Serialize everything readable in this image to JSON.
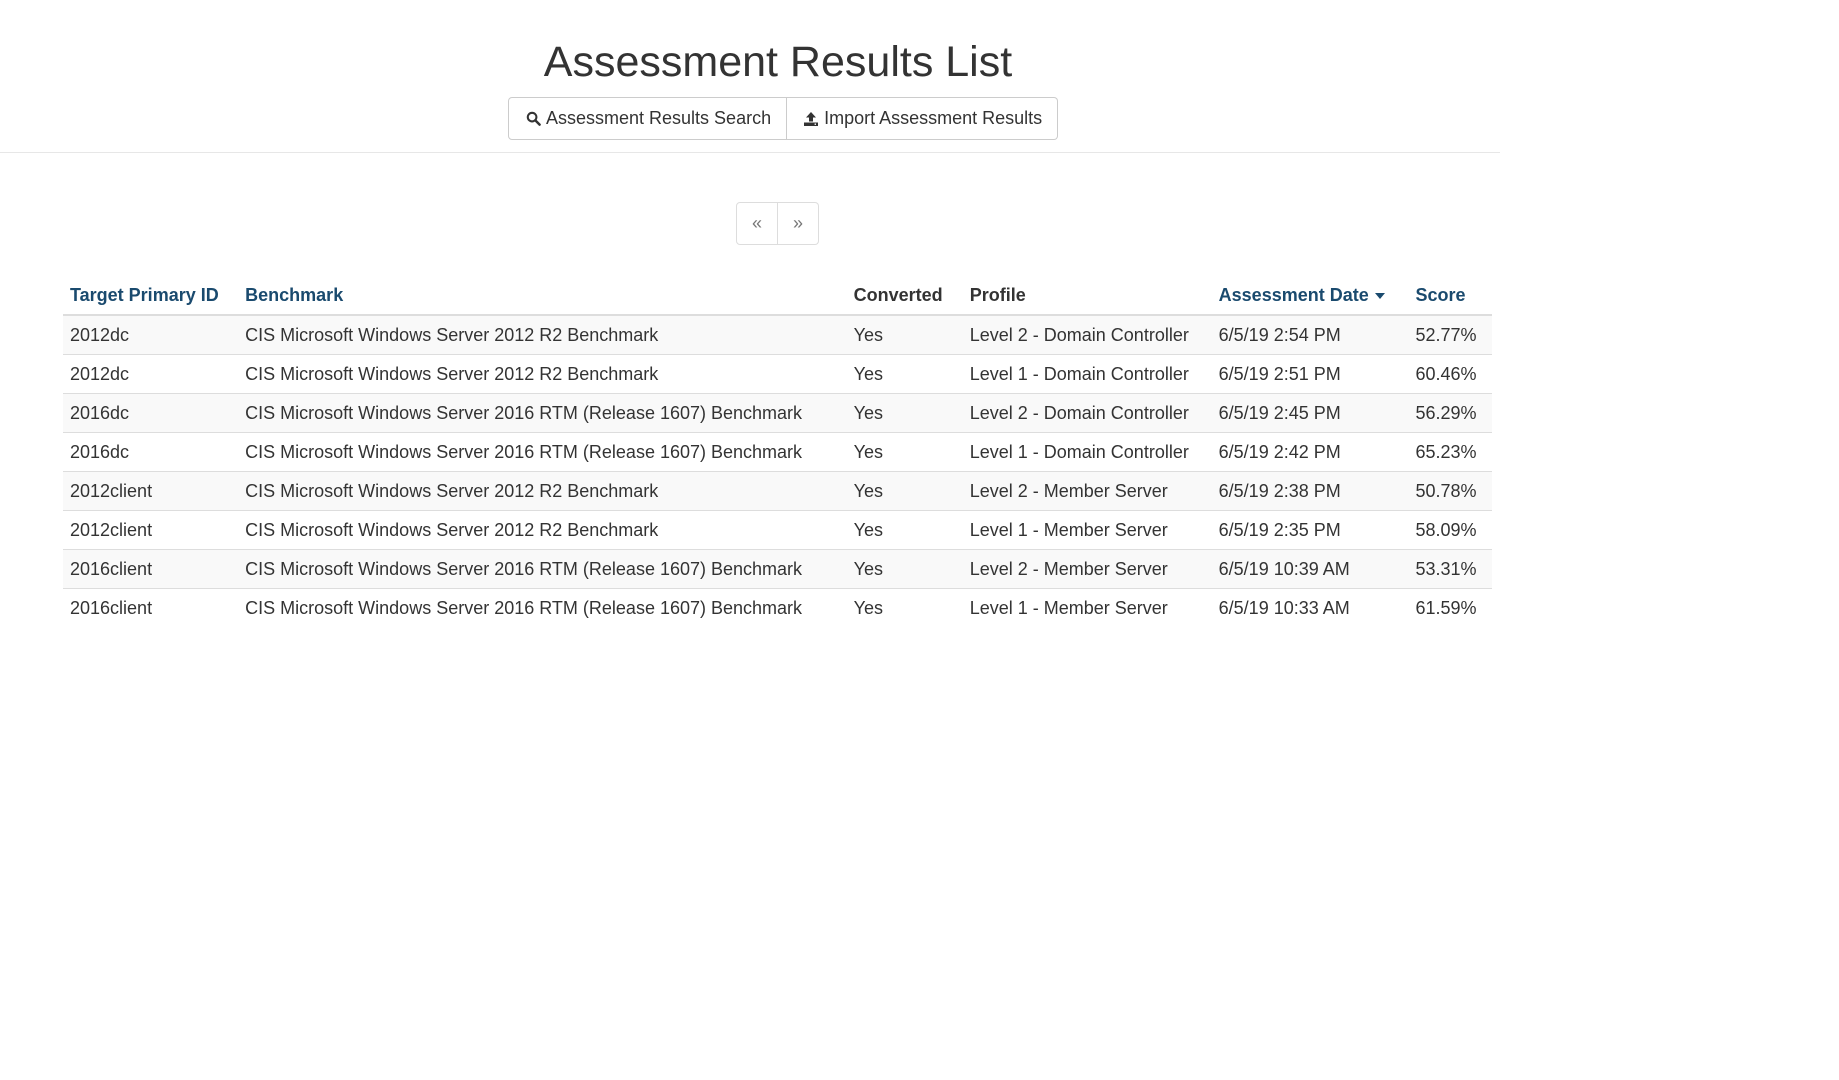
{
  "page": {
    "title": "Assessment Results List"
  },
  "toolbar": {
    "search_label": "Assessment Results Search",
    "import_label": "Import Assessment Results",
    "search_icon": "search-icon",
    "import_icon": "upload-icon"
  },
  "pager": {
    "prev_label": "«",
    "next_label": "»"
  },
  "table": {
    "headers": {
      "target_id": "Target Primary ID",
      "benchmark": "Benchmark",
      "converted": "Converted",
      "profile": "Profile",
      "assessment_date": "Assessment Date",
      "score": "Score"
    },
    "sort": {
      "column": "assessment_date",
      "direction": "desc"
    },
    "link_color": "#1a4a6e",
    "rows": [
      {
        "target_id": "2012dc",
        "benchmark": "CIS Microsoft Windows Server 2012 R2 Benchmark",
        "converted": "Yes",
        "profile": "Level 2 - Domain Controller",
        "date": "6/5/19 2:54 PM",
        "score": "52.77%"
      },
      {
        "target_id": "2012dc",
        "benchmark": "CIS Microsoft Windows Server 2012 R2 Benchmark",
        "converted": "Yes",
        "profile": "Level 1 - Domain Controller",
        "date": "6/5/19 2:51 PM",
        "score": "60.46%"
      },
      {
        "target_id": "2016dc",
        "benchmark": "CIS Microsoft Windows Server 2016 RTM (Release 1607) Benchmark",
        "converted": "Yes",
        "profile": "Level 2 - Domain Controller",
        "date": "6/5/19 2:45 PM",
        "score": "56.29%"
      },
      {
        "target_id": "2016dc",
        "benchmark": "CIS Microsoft Windows Server 2016 RTM (Release 1607) Benchmark",
        "converted": "Yes",
        "profile": "Level 1 - Domain Controller",
        "date": "6/5/19 2:42 PM",
        "score": "65.23%"
      },
      {
        "target_id": "2012client",
        "benchmark": "CIS Microsoft Windows Server 2012 R2 Benchmark",
        "converted": "Yes",
        "profile": "Level 2 - Member Server",
        "date": "6/5/19 2:38 PM",
        "score": "50.78%"
      },
      {
        "target_id": "2012client",
        "benchmark": "CIS Microsoft Windows Server 2012 R2 Benchmark",
        "converted": "Yes",
        "profile": "Level 1 - Member Server",
        "date": "6/5/19 2:35 PM",
        "score": "58.09%"
      },
      {
        "target_id": "2016client",
        "benchmark": "CIS Microsoft Windows Server 2016 RTM (Release 1607) Benchmark",
        "converted": "Yes",
        "profile": "Level 2 - Member Server",
        "date": "6/5/19 10:39 AM",
        "score": "53.31%"
      },
      {
        "target_id": "2016client",
        "benchmark": "CIS Microsoft Windows Server 2016 RTM (Release 1607) Benchmark",
        "converted": "Yes",
        "profile": "Level 1 - Member Server",
        "date": "6/5/19 10:33 AM",
        "score": "61.59%"
      }
    ]
  }
}
